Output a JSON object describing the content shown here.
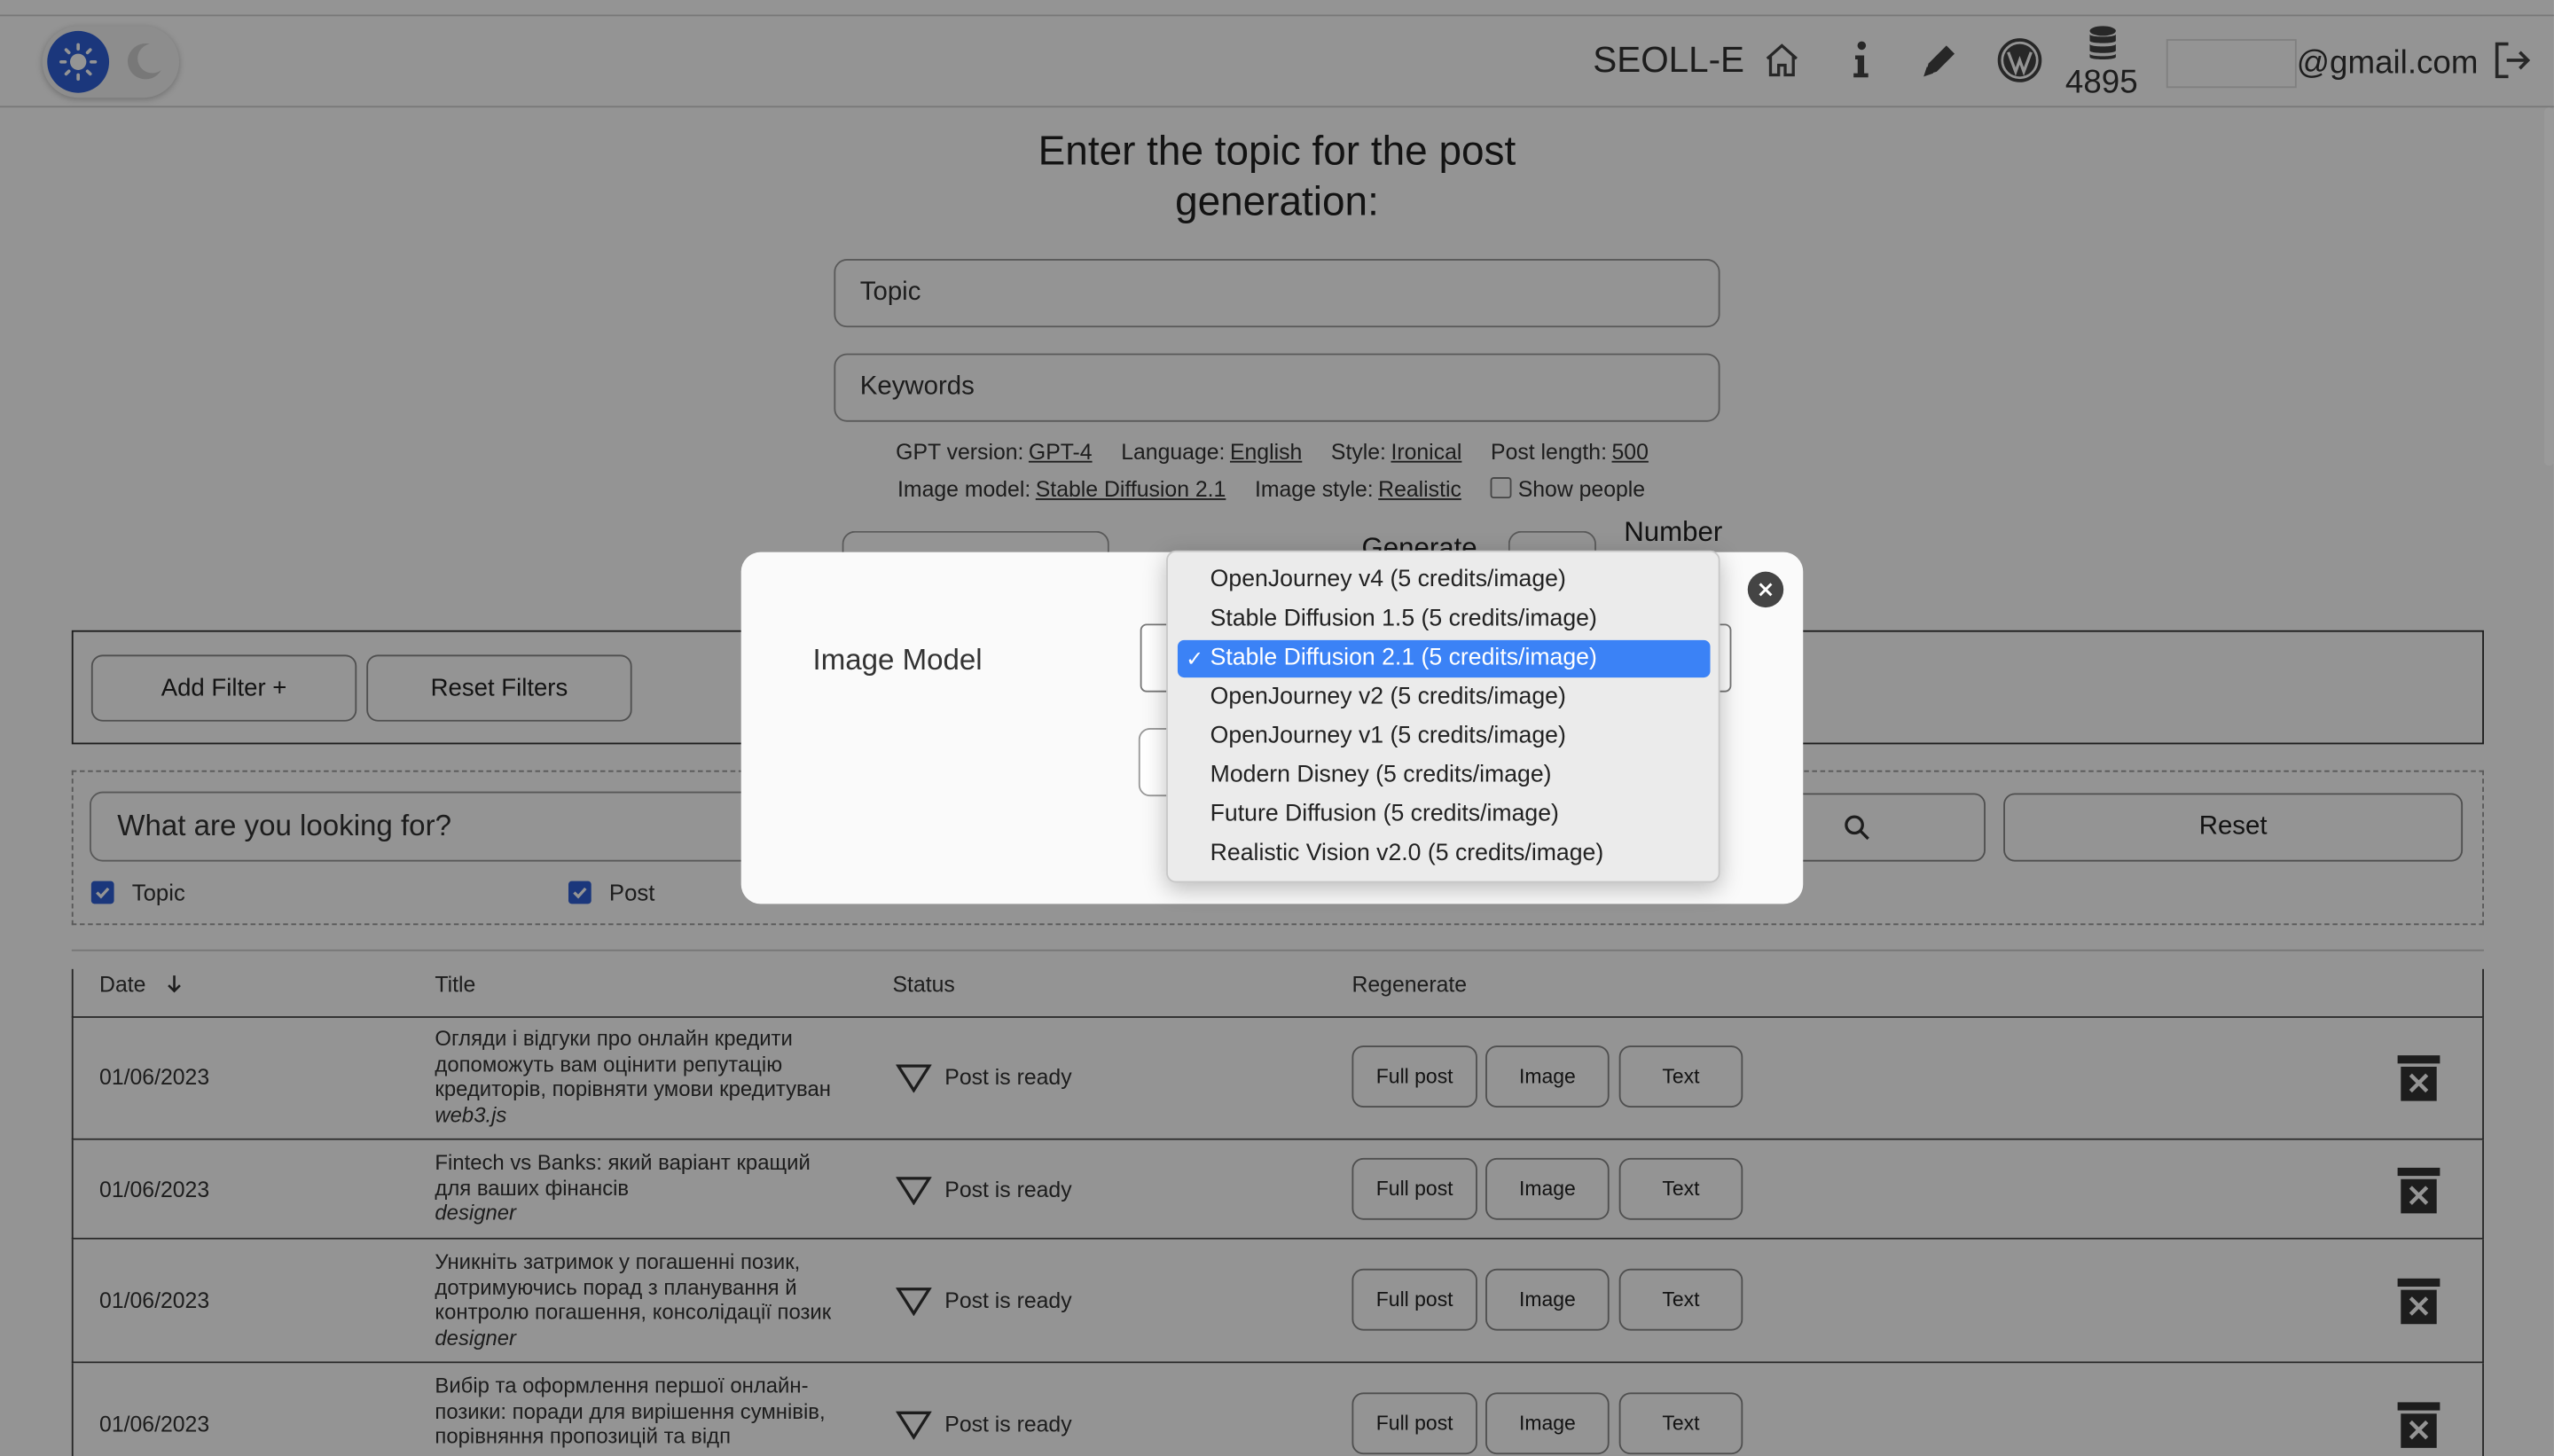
{
  "header": {
    "brand": "SEOLL-E",
    "credits": "4895",
    "email_suffix": "@gmail.com"
  },
  "form": {
    "title": "Enter the topic for the post generation:",
    "topic_placeholder": "Topic",
    "keywords_placeholder": "Keywords",
    "settings": {
      "gpt_label": "GPT version:",
      "gpt_value": "GPT-4",
      "lang_label": "Language:",
      "lang_value": "English",
      "style_label": "Style:",
      "style_value": "Ironical",
      "length_label": "Post length:",
      "length_value": "500",
      "image_model_label": "Image model:",
      "image_model_value": "Stable Diffusion 2.1",
      "image_style_label": "Image style:",
      "image_style_value": "Realistic",
      "show_people_label": "Show people"
    },
    "generate_label": "Generate",
    "number_label": "Number"
  },
  "filters": {
    "add_filter": "Add Filter +",
    "reset_filters": "Reset Filters"
  },
  "search": {
    "placeholder": "What are you looking for?",
    "reset": "Reset",
    "cb_topic": "Topic",
    "cb_post": "Post"
  },
  "table": {
    "headers": {
      "date": "Date",
      "title": "Title",
      "status": "Status",
      "regenerate": "Regenerate"
    },
    "buttons": {
      "full_post": "Full post",
      "image": "Image",
      "text": "Text"
    },
    "rows": [
      {
        "date": "01/06/2023",
        "title_lines": [
          "Огляди і відгуки про онлайн кредити",
          "допоможуть вам оцінити репутацію",
          "кредиторів, порівняти умови кредитуван"
        ],
        "keyword": "web3.js",
        "status": "Post is ready"
      },
      {
        "date": "01/06/2023",
        "title_lines": [
          "Fintech vs Banks: який варіант кращий",
          "для ваших фінансів"
        ],
        "keyword": "designer",
        "status": "Post is ready"
      },
      {
        "date": "01/06/2023",
        "title_lines": [
          "Уникніть затримок у погашенні позик,",
          "дотримуючись порад з планування й",
          "контролю погашення, консолідації позик"
        ],
        "keyword": "designer",
        "status": "Post is ready"
      },
      {
        "date": "01/06/2023",
        "title_lines": [
          "Вибір та оформлення першої онлайн-",
          "позики: поради для вирішення сумнівів,",
          "порівняння пропозицій та відп"
        ],
        "keyword": "",
        "status": "Post is ready"
      }
    ]
  },
  "modal": {
    "label": "Image Model",
    "selected_index": 2,
    "options": [
      "OpenJourney v4 (5 credits/image)",
      "Stable Diffusion 1.5 (5 credits/image)",
      "Stable Diffusion 2.1 (5 credits/image)",
      "OpenJourney v2 (5 credits/image)",
      "OpenJourney v1 (5 credits/image)",
      "Modern Disney (5 credits/image)",
      "Future Diffusion (5 credits/image)",
      "Realistic Vision v2.0 (5 credits/image)"
    ]
  },
  "colors": {
    "accent": "#2f5fd6",
    "selected_option": "#3b82f6"
  }
}
